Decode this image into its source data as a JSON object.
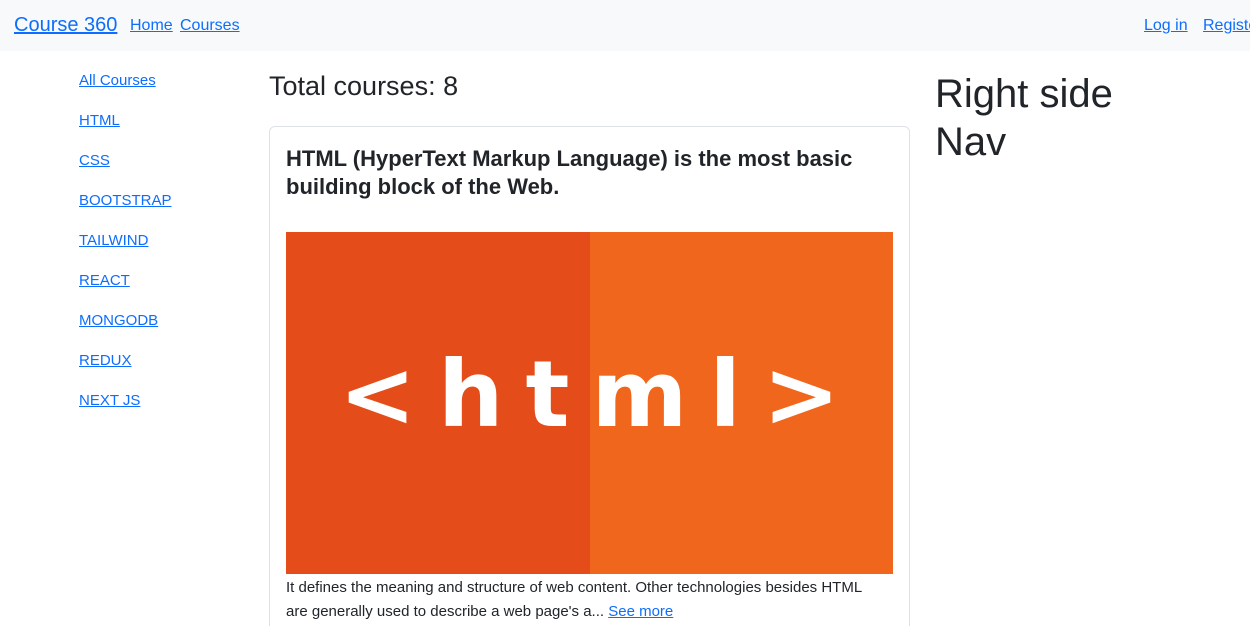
{
  "navbar": {
    "brand": "Course 360",
    "links": [
      {
        "label": "Home"
      },
      {
        "label": "Courses"
      }
    ],
    "auth": {
      "login": "Log in",
      "register": "Registe"
    }
  },
  "sidebar": {
    "items": [
      {
        "label": "All Courses"
      },
      {
        "label": "HTML"
      },
      {
        "label": "CSS"
      },
      {
        "label": "BOOTSTRAP"
      },
      {
        "label": "TAILWIND"
      },
      {
        "label": "REACT"
      },
      {
        "label": "MONGODB"
      },
      {
        "label": "REDUX"
      },
      {
        "label": "NEXT JS"
      }
    ]
  },
  "main": {
    "total_label": "Total courses: 8",
    "card": {
      "title": "HTML (HyperText Markup Language) is the most basic building block of the Web.",
      "image_text": "<html>",
      "image_colors": {
        "left": "#e44d1a",
        "right": "#f1661d"
      },
      "description": "It defines the meaning and structure of web content. Other technologies besides HTML are generally used to describe a web page's a...",
      "see_more": "See more"
    }
  },
  "right_nav": {
    "title_line1": "Right side",
    "title_line2": "Nav"
  },
  "colors": {
    "link": "#0d6efd",
    "navbar_bg": "#f8f9fa",
    "text": "#212529"
  }
}
